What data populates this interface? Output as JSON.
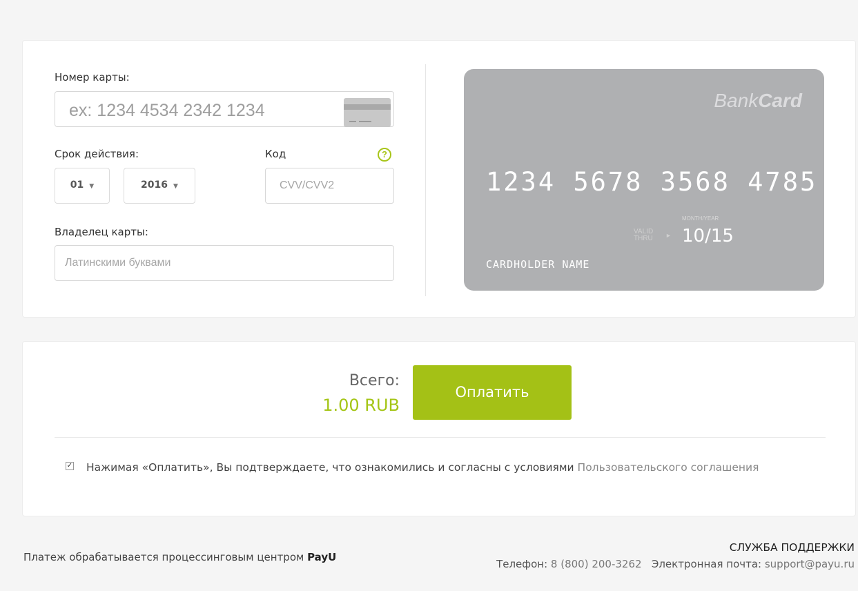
{
  "card_form": {
    "card_number_label": "Номер карты:",
    "card_number_placeholder": "ex: 1234 4534 2342 1234",
    "expiry_label": "Срок действия:",
    "expiry_month": "01",
    "expiry_year": "2016",
    "cvv_label": "Код",
    "cvv_placeholder": "CVV/CVV2",
    "help_symbol": "?",
    "holder_label": "Владелец карты:",
    "holder_placeholder": "Латинскими буквами"
  },
  "bank_card": {
    "brand_prefix": "Bank",
    "brand_suffix": "Card",
    "number": "1234 5678 3568 4785",
    "month_year_caption": "MONTH/YEAR",
    "valid_caption_1": "VALID",
    "valid_caption_2": "THRU",
    "expiry": "10/15",
    "holder": "CARDHOLDER NAME"
  },
  "payment": {
    "total_label": "Всего:",
    "total_amount": "1.00 RUB",
    "pay_button": "Оплатить",
    "agree_checked": true,
    "agree_text": "Нажимая «Оплатить», Вы подтверждаете, что ознакомились и согласны с условиями ",
    "agree_link": "Пользовательского соглашения"
  },
  "footer": {
    "processing_text": "Платеж обрабатывается процессинговым центром ",
    "processing_brand": "PayU",
    "support_title": "СЛУЖБА ПОДДЕРЖКИ",
    "phone_label": "Телефон: ",
    "phone": "8 (800) 200-3262",
    "email_label": "Электронная почта: ",
    "email": "support@payu.ru"
  },
  "colors": {
    "accent": "#a4c116",
    "card_background": "#afb0b2",
    "page_background": "#f5f5f5"
  }
}
